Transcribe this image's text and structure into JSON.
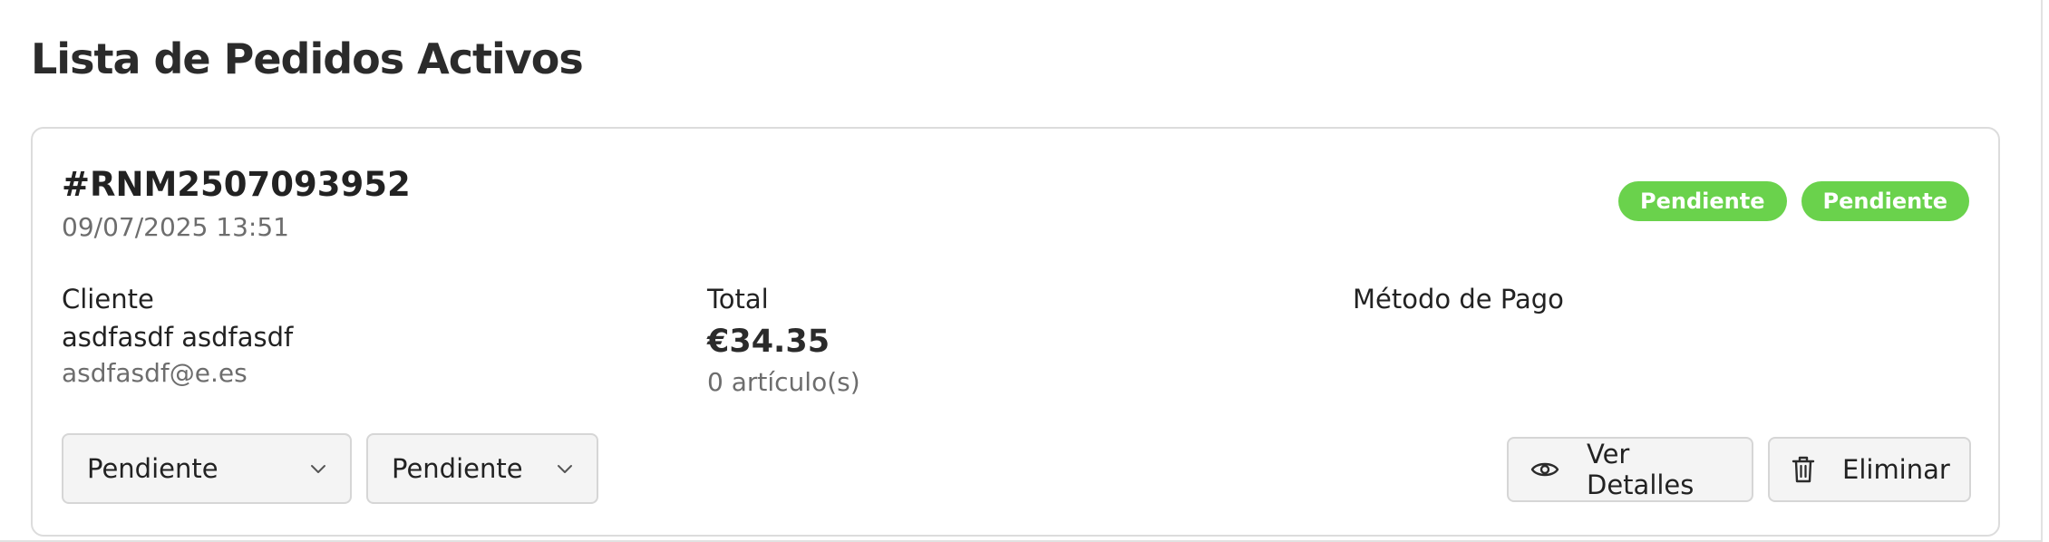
{
  "page": {
    "title": "Lista de Pedidos Activos"
  },
  "order": {
    "id": "#RNM2507093952",
    "date": "09/07/2025 13:51",
    "badges": [
      "Pendiente",
      "Pendiente"
    ],
    "badge_color": "#6ad24c",
    "cliente": {
      "label": "Cliente",
      "name": "asdfasdf asdfasdf",
      "email": "asdfasdf@e.es"
    },
    "total": {
      "label": "Total",
      "amount": "€34.35",
      "items": "0 artículo(s)"
    },
    "pago": {
      "label": "Método de Pago"
    },
    "selects": {
      "status_1": "Pendiente",
      "status_2": "Pendiente"
    },
    "actions": {
      "details_label": "Ver Detalles",
      "delete_label": "Eliminar",
      "details_icon": "eye-icon",
      "delete_icon": "trash-icon"
    }
  }
}
